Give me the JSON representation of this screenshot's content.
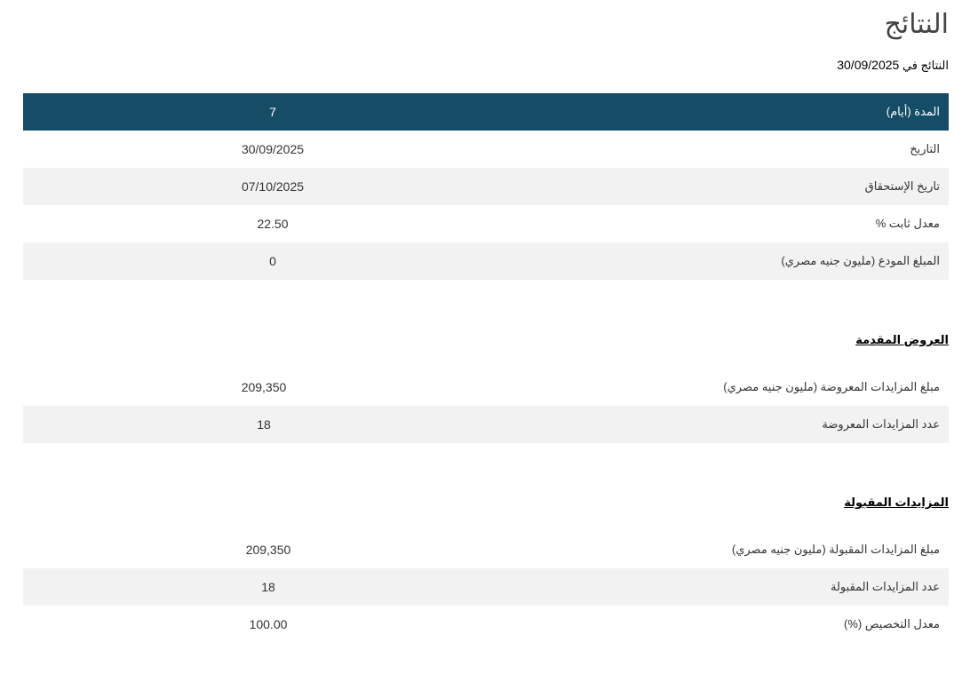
{
  "page": {
    "title": "النتائج",
    "results_date_label": "النتائج في",
    "results_date_value": "30/09/2025"
  },
  "auction_table": {
    "rows": [
      {
        "label": "المدة (أيام)",
        "value": "7"
      },
      {
        "label": "التاريخ",
        "value": "30/09/2025"
      },
      {
        "label": "تاريخ الإستحقاق",
        "value": "07/10/2025"
      },
      {
        "label": "معدل ثابت %",
        "value": "22.50"
      },
      {
        "label": "المبلغ المودع (مليون جنيه مصري)",
        "value": "0"
      }
    ]
  },
  "offers_section": {
    "heading": "العروض المقدمة",
    "rows": [
      {
        "label": "مبلغ المزايدات المعروضة (مليون جنيه مصري)",
        "value": "209,350"
      },
      {
        "label": "عدد المزايدات المعروضة",
        "value": "18"
      }
    ]
  },
  "accepted_section": {
    "heading": "المزايدات المقبولة",
    "rows": [
      {
        "label": "مبلغ المزايدات المقبولة (مليون جنيه مصري)",
        "value": "209,350"
      },
      {
        "label": "عدد المزايدات المقبولة",
        "value": "18"
      },
      {
        "label": "معدل التخصيص (%)",
        "value": "100.00"
      }
    ]
  },
  "colors": {
    "header_background": "#154c66",
    "alternate_row_background": "#f2f2f2"
  }
}
